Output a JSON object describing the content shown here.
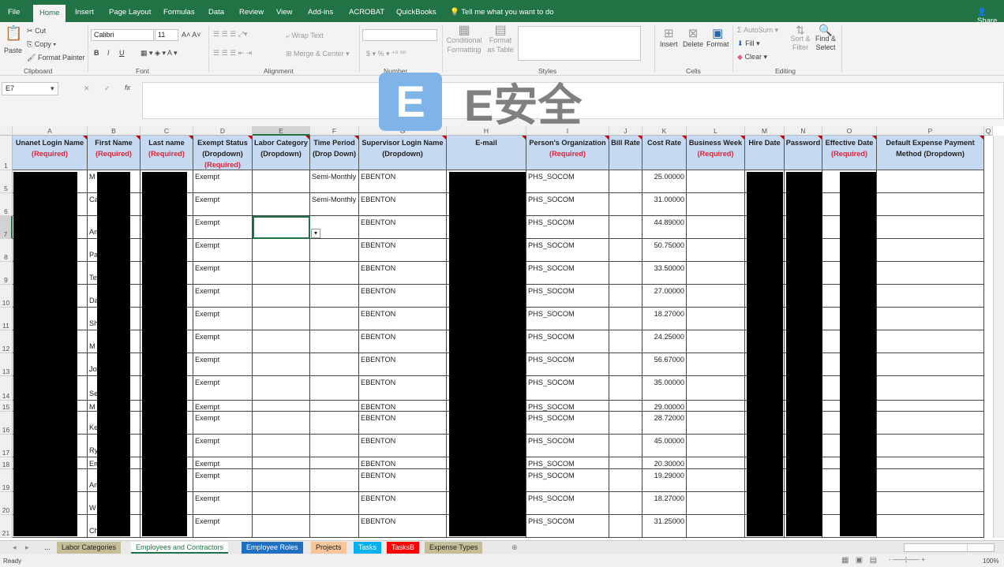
{
  "tabs": [
    "File",
    "Home",
    "Insert",
    "Page Layout",
    "Formulas",
    "Data",
    "Review",
    "View",
    "Add-ins",
    "ACROBAT",
    "QuickBooks"
  ],
  "tell_me": "Tell me what you want to do",
  "share": "Share",
  "ribbon": {
    "clipboard": {
      "paste": "Paste",
      "cut": "Cut",
      "copy": "Copy",
      "format_painter": "Format Painter",
      "label": "Clipboard"
    },
    "font": {
      "name": "Calibri",
      "size": "11",
      "label": "Font",
      "bold": "B",
      "italic": "I",
      "underline": "U"
    },
    "alignment": {
      "wrap": "Wrap Text",
      "merge": "Merge & Center",
      "label": "Alignment"
    },
    "number": {
      "label": "Number",
      "currency": "$",
      "percent": "%"
    },
    "styles": {
      "conditional": "Conditional Formatting",
      "format_table": "Format as Table",
      "label": "Styles"
    },
    "cells": {
      "insert": "Insert",
      "delete": "Delete",
      "format": "Format",
      "label": "Cells"
    },
    "editing": {
      "autosum": "AutoSum",
      "fill": "Fill",
      "clear": "Clear",
      "sort": "Sort & Filter",
      "find": "Find & Select",
      "label": "Editing"
    }
  },
  "name_box": "E7",
  "fx": "fx",
  "watermark": "E安全",
  "columns": [
    "A",
    "B",
    "C",
    "D",
    "E",
    "F",
    "G",
    "H",
    "I",
    "J",
    "K",
    "L",
    "M",
    "N",
    "O",
    "P",
    "Q"
  ],
  "headers": [
    {
      "t": "Unanet Login Name",
      "r": "(Required)"
    },
    {
      "t": "First Name",
      "r": "(Required)"
    },
    {
      "t": "Last name",
      "r": "(Required)"
    },
    {
      "t": "Exempt Status (Dropdown)",
      "r": "(Required)"
    },
    {
      "t": "Labor Category (Dropdown)",
      "r": ""
    },
    {
      "t": "Time Period (Drop Down)",
      "r": ""
    },
    {
      "t": "Supervisor Login Name (Dropdown)",
      "r": ""
    },
    {
      "t": "E-mail",
      "r": ""
    },
    {
      "t": "Person's Organization",
      "r": "(Required)"
    },
    {
      "t": "Bill Rate",
      "r": ""
    },
    {
      "t": "Cost Rate",
      "r": ""
    },
    {
      "t": "Business Week",
      "r": "(Required)"
    },
    {
      "t": "Hire Date",
      "r": ""
    },
    {
      "t": "Password",
      "r": ""
    },
    {
      "t": "Effective Date",
      "r": "(Required)"
    },
    {
      "t": "Default Expense Payment Method (Dropdown)",
      "r": ""
    }
  ],
  "rows": [
    {
      "n": "5",
      "first": "M",
      "exempt": "Exempt",
      "period": "Semi-Monthly",
      "sup": "EBENTON",
      "org": "PHS_SOCOM",
      "cost": "25.00000"
    },
    {
      "n": "6",
      "first": "Ca",
      "exempt": "Exempt",
      "period": "Semi-Monthly",
      "sup": "EBENTON",
      "org": "PHS_SOCOM",
      "cost": "31.00000"
    },
    {
      "n": "7",
      "first": "An",
      "exempt": "Exempt",
      "period": "",
      "sup": "EBENTON",
      "org": "PHS_SOCOM",
      "cost": "44.89000"
    },
    {
      "n": "8",
      "first": "Pa",
      "exempt": "Exempt",
      "period": "",
      "sup": "EBENTON",
      "org": "PHS_SOCOM",
      "cost": "50.75000"
    },
    {
      "n": "9",
      "first": "Te",
      "exempt": "Exempt",
      "period": "",
      "sup": "EBENTON",
      "org": "PHS_SOCOM",
      "cost": "33.50000"
    },
    {
      "n": "10",
      "first": "Da",
      "exempt": "Exempt",
      "period": "",
      "sup": "EBENTON",
      "org": "PHS_SOCOM",
      "cost": "27.00000"
    },
    {
      "n": "11",
      "first": "Sh",
      "exempt": "Exempt",
      "period": "",
      "sup": "EBENTON",
      "org": "PHS_SOCOM",
      "cost": "18.27000"
    },
    {
      "n": "12",
      "first": "M",
      "exempt": "Exempt",
      "period": "",
      "sup": "EBENTON",
      "org": "PHS_SOCOM",
      "cost": "24.25000"
    },
    {
      "n": "13",
      "first": "Jo",
      "exempt": "Exempt",
      "period": "",
      "sup": "EBENTON",
      "org": "PHS_SOCOM",
      "cost": "56.67000"
    },
    {
      "n": "14",
      "first": "Se",
      "exempt": "Exempt",
      "period": "",
      "sup": "EBENTON",
      "org": "PHS_SOCOM",
      "cost": "35.00000"
    },
    {
      "n": "15",
      "first": "M",
      "exempt": "Exempt",
      "period": "",
      "sup": "EBENTON",
      "org": "PHS_SOCOM",
      "cost": "29.00000"
    },
    {
      "n": "16",
      "first": "Ke",
      "exempt": "Exempt",
      "period": "",
      "sup": "EBENTON",
      "org": "PHS_SOCOM",
      "cost": "28.72000"
    },
    {
      "n": "17",
      "first": "Ry",
      "exempt": "Exempt",
      "period": "",
      "sup": "EBENTON",
      "org": "PHS_SOCOM",
      "cost": "45.00000"
    },
    {
      "n": "18",
      "first": "Em",
      "exempt": "Exempt",
      "period": "",
      "sup": "EBENTON",
      "org": "PHS_SOCOM",
      "cost": "20.30000"
    },
    {
      "n": "19",
      "first": "An",
      "exempt": "Exempt",
      "period": "",
      "sup": "EBENTON",
      "org": "PHS_SOCOM",
      "cost": "19.29000"
    },
    {
      "n": "20",
      "first": "W",
      "exempt": "Exempt",
      "period": "",
      "sup": "EBENTON",
      "org": "PHS_SOCOM",
      "cost": "18.27000"
    },
    {
      "n": "21",
      "first": "Ch",
      "exempt": "Exempt",
      "period": "",
      "sup": "EBENTON",
      "org": "PHS_SOCOM",
      "cost": "31.25000"
    }
  ],
  "sheets": [
    {
      "label": "Labor Categories",
      "color": "#c4bd97"
    },
    {
      "label": "Employees and Contractors",
      "color": "#ffffff",
      "active": true
    },
    {
      "label": "Employee Roles",
      "color": "#1f6fc2"
    },
    {
      "label": "Projects",
      "color": "#f8c49a"
    },
    {
      "label": "Tasks",
      "color": "#00b0f0"
    },
    {
      "label": "TasksB",
      "color": "#ff0000"
    },
    {
      "label": "Expense Types",
      "color": "#c4bd97"
    }
  ],
  "sheet_more": "...",
  "status": {
    "ready": "Ready",
    "zoom": "100%"
  }
}
